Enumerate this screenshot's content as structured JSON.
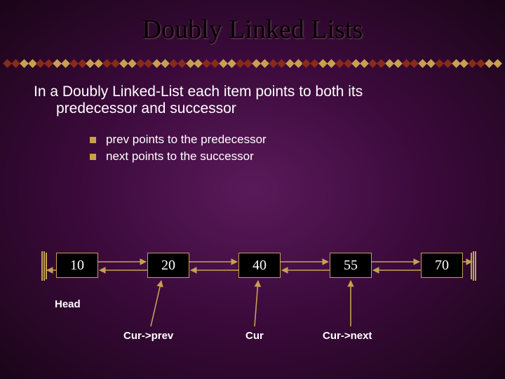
{
  "title": "Doubly Linked Lists",
  "intro_line1": "In a Doubly Linked-List each item points to both its",
  "intro_line2": "predecessor and successor",
  "bullets": {
    "b0": "prev points to the predecessor",
    "b1": "next points to the successor"
  },
  "nodes": {
    "v0": "10",
    "v1": "20",
    "v2": "40",
    "v3": "55",
    "v4": "70"
  },
  "labels": {
    "head": "Head",
    "cur": "Cur",
    "cur_prev": "Cur->prev",
    "cur_next": "Cur->next"
  }
}
